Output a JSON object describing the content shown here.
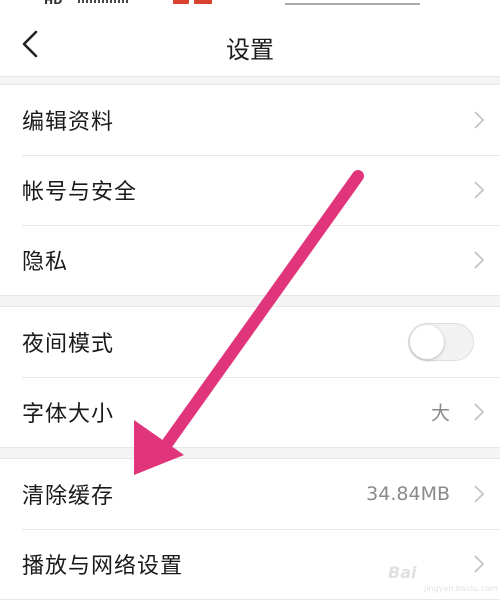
{
  "status_bar": {
    "hd_label": "HD"
  },
  "header": {
    "title": "设置",
    "back_icon": "chevron-left-icon"
  },
  "sections": [
    {
      "items": [
        {
          "label": "编辑资料",
          "value": ""
        },
        {
          "label": "帐号与安全",
          "value": ""
        },
        {
          "label": "隐私",
          "value": ""
        }
      ]
    },
    {
      "items": [
        {
          "label": "夜间模式",
          "toggle": true,
          "toggle_on": false
        },
        {
          "label": "字体大小",
          "value": "大"
        }
      ]
    },
    {
      "items": [
        {
          "label": "清除缓存",
          "value": "34.84MB"
        },
        {
          "label": "播放与网络设置",
          "value": ""
        }
      ]
    }
  ],
  "annotation": {
    "arrow_color": "#e0357a"
  },
  "watermark": {
    "text": "Bai",
    "sub": "jingyan.baidu.com"
  }
}
